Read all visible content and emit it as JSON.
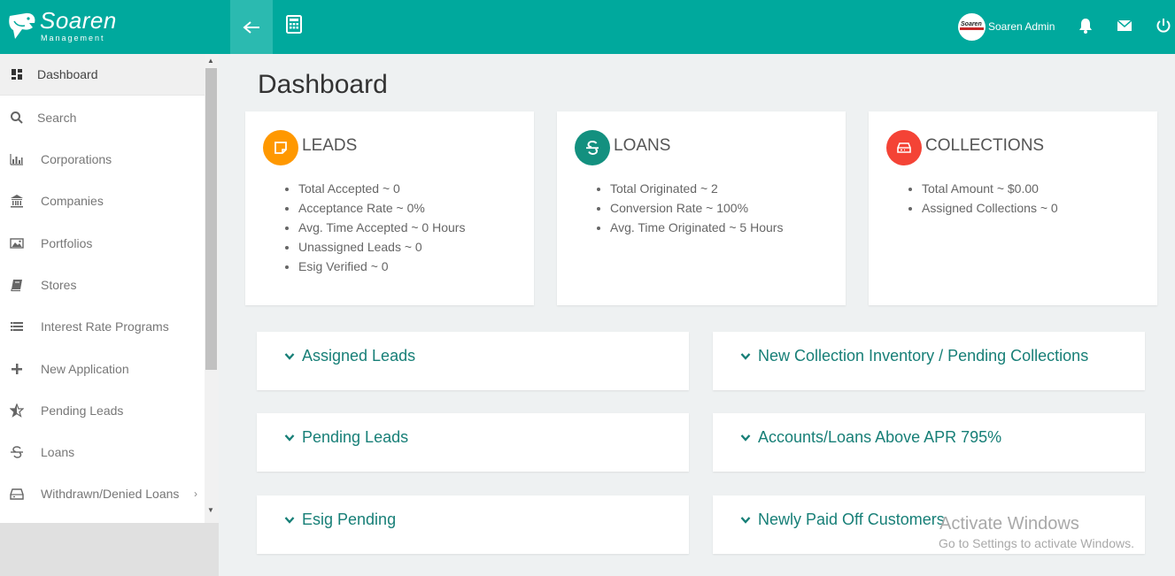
{
  "brand": {
    "name": "Soaren",
    "tagline": "Management"
  },
  "header": {
    "back_icon": "arrow-left-icon",
    "calculator_icon": "calculator-icon",
    "user_name": "Soaren Admin",
    "avatar_text": "Soaren",
    "notifications_icon": "bell-icon",
    "mail_icon": "envelope-icon",
    "power_icon": "power-icon"
  },
  "sidebar": {
    "items": [
      {
        "label": "Dashboard",
        "icon": "dashboard-icon",
        "active": true
      },
      {
        "label": "Search",
        "icon": "search-icon"
      },
      {
        "label": "Corporations",
        "icon": "bar-chart-icon"
      },
      {
        "label": "Companies",
        "icon": "bank-icon"
      },
      {
        "label": "Portfolios",
        "icon": "image-icon"
      },
      {
        "label": "Stores",
        "icon": "book-icon"
      },
      {
        "label": "Interest Rate Programs",
        "icon": "list-icon"
      },
      {
        "label": "New Application",
        "icon": "plus-icon"
      },
      {
        "label": "Pending Leads",
        "icon": "star-half-icon"
      },
      {
        "label": "Loans",
        "icon": "strikethrough-s-icon"
      },
      {
        "label": "Withdrawn/Denied Loans",
        "icon": "inbox-icon",
        "has_submenu": true
      }
    ]
  },
  "main": {
    "title": "Dashboard",
    "cards": [
      {
        "title": "LEADS",
        "icon": "sticky-note-icon",
        "color": "#ff9800",
        "items": [
          "Total Accepted ~ 0",
          "Acceptance Rate ~ 0%",
          "Avg. Time Accepted ~ 0 Hours",
          "Unassigned Leads ~ 0",
          "Esig Verified ~ 0"
        ]
      },
      {
        "title": "LOANS",
        "icon": "strikethrough-s-icon",
        "color": "#13907f",
        "items": [
          "Total Originated ~ 2",
          "Conversion Rate ~ 100%",
          "Avg. Time Originated ~ 5 Hours"
        ]
      },
      {
        "title": "COLLECTIONS",
        "icon": "inbox-icon",
        "color": "#f44336",
        "items": [
          "Total Amount ~ $0.00",
          "Assigned Collections ~ 0"
        ]
      }
    ],
    "panels": [
      "Assigned Leads",
      "New Collection Inventory / Pending Collections",
      "Pending Leads",
      "Accounts/Loans Above APR 795%",
      "Esig Pending",
      "Newly Paid Off Customers"
    ]
  },
  "watermark": {
    "line1": "Activate Windows",
    "line2": "Go to Settings to activate Windows."
  }
}
